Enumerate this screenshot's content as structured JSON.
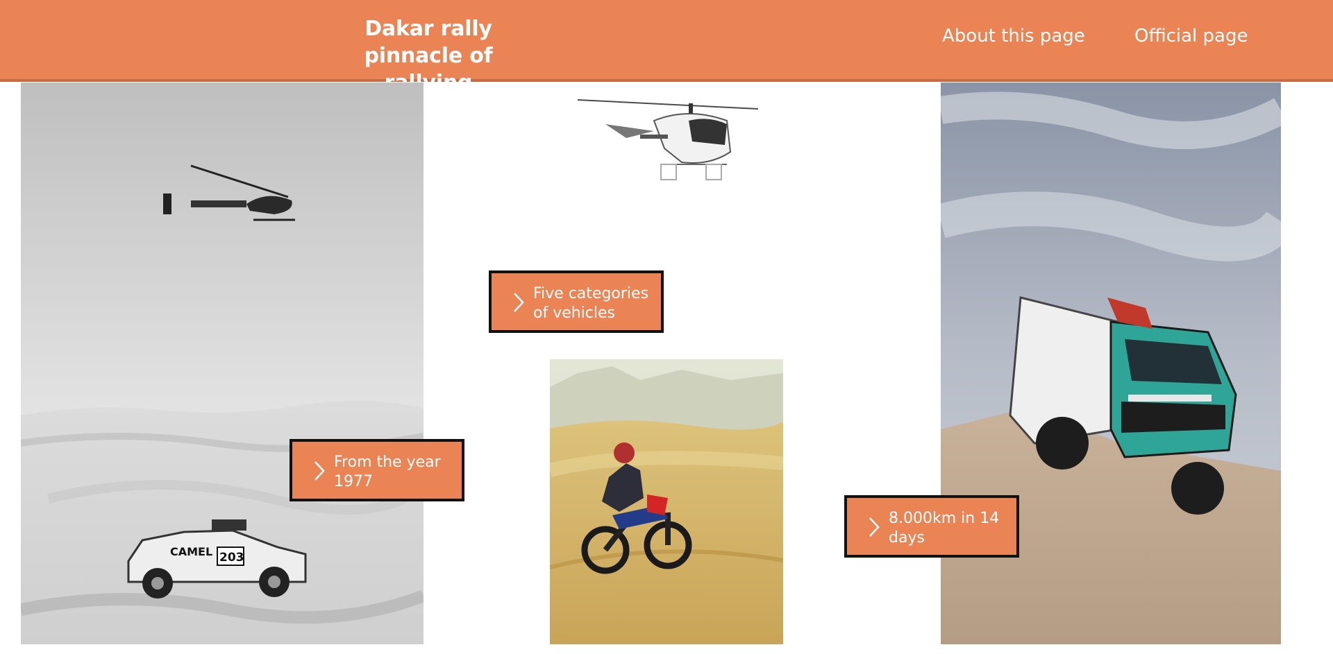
{
  "header": {
    "title_line1": "Dakar rally",
    "title_line2": "pinnacle of rallying",
    "nav": {
      "about": "About this page",
      "official": "Official page"
    }
  },
  "cards": {
    "year": "From the year 1977",
    "categories": "Five categories of vehicles",
    "distance": "8.000km in 14 days"
  },
  "images": {
    "car_number": "203",
    "car_sponsor": "CAMEL"
  },
  "colors": {
    "accent": "#EB8455",
    "border": "#111111",
    "text_on_accent": "#FFFFFF"
  },
  "icons": {
    "cta_arrow": "chevron-right-icon"
  }
}
